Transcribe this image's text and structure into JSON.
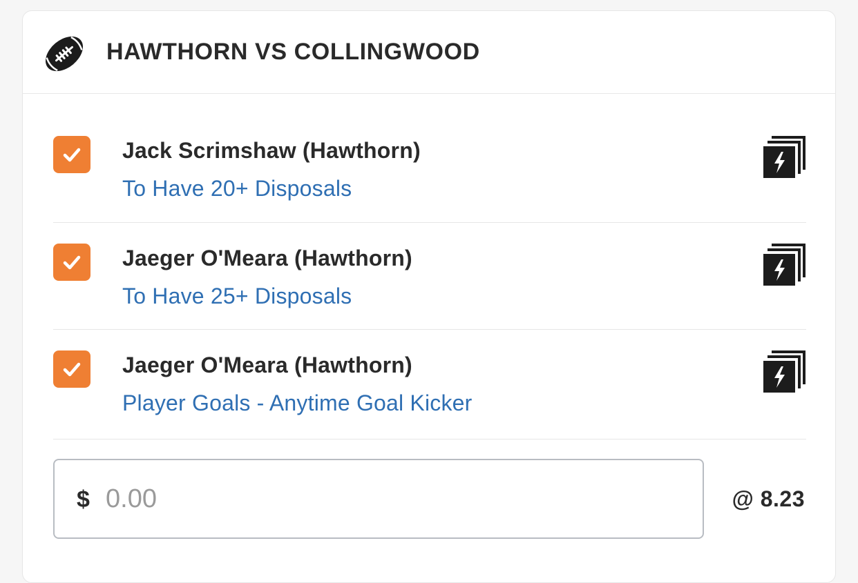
{
  "match": {
    "title": "HAWTHORN VS COLLINGWOOD",
    "icon": "football-icon"
  },
  "selections": [
    {
      "player": "Jack Scrimshaw (Hawthorn)",
      "market": "To Have 20+ Disposals",
      "checked": true
    },
    {
      "player": "Jaeger O'Meara (Hawthorn)",
      "market": "To Have 25+ Disposals",
      "checked": true
    },
    {
      "player": "Jaeger O'Meara (Hawthorn)",
      "market": "Player Goals - Anytime Goal Kicker",
      "checked": true
    }
  ],
  "stake": {
    "currency": "$",
    "placeholder": "0.00",
    "value": ""
  },
  "odds": "@ 8.23",
  "colors": {
    "checkbox": "#ef7f33",
    "market_link": "#2f6fb3",
    "text": "#2a2a2a"
  }
}
